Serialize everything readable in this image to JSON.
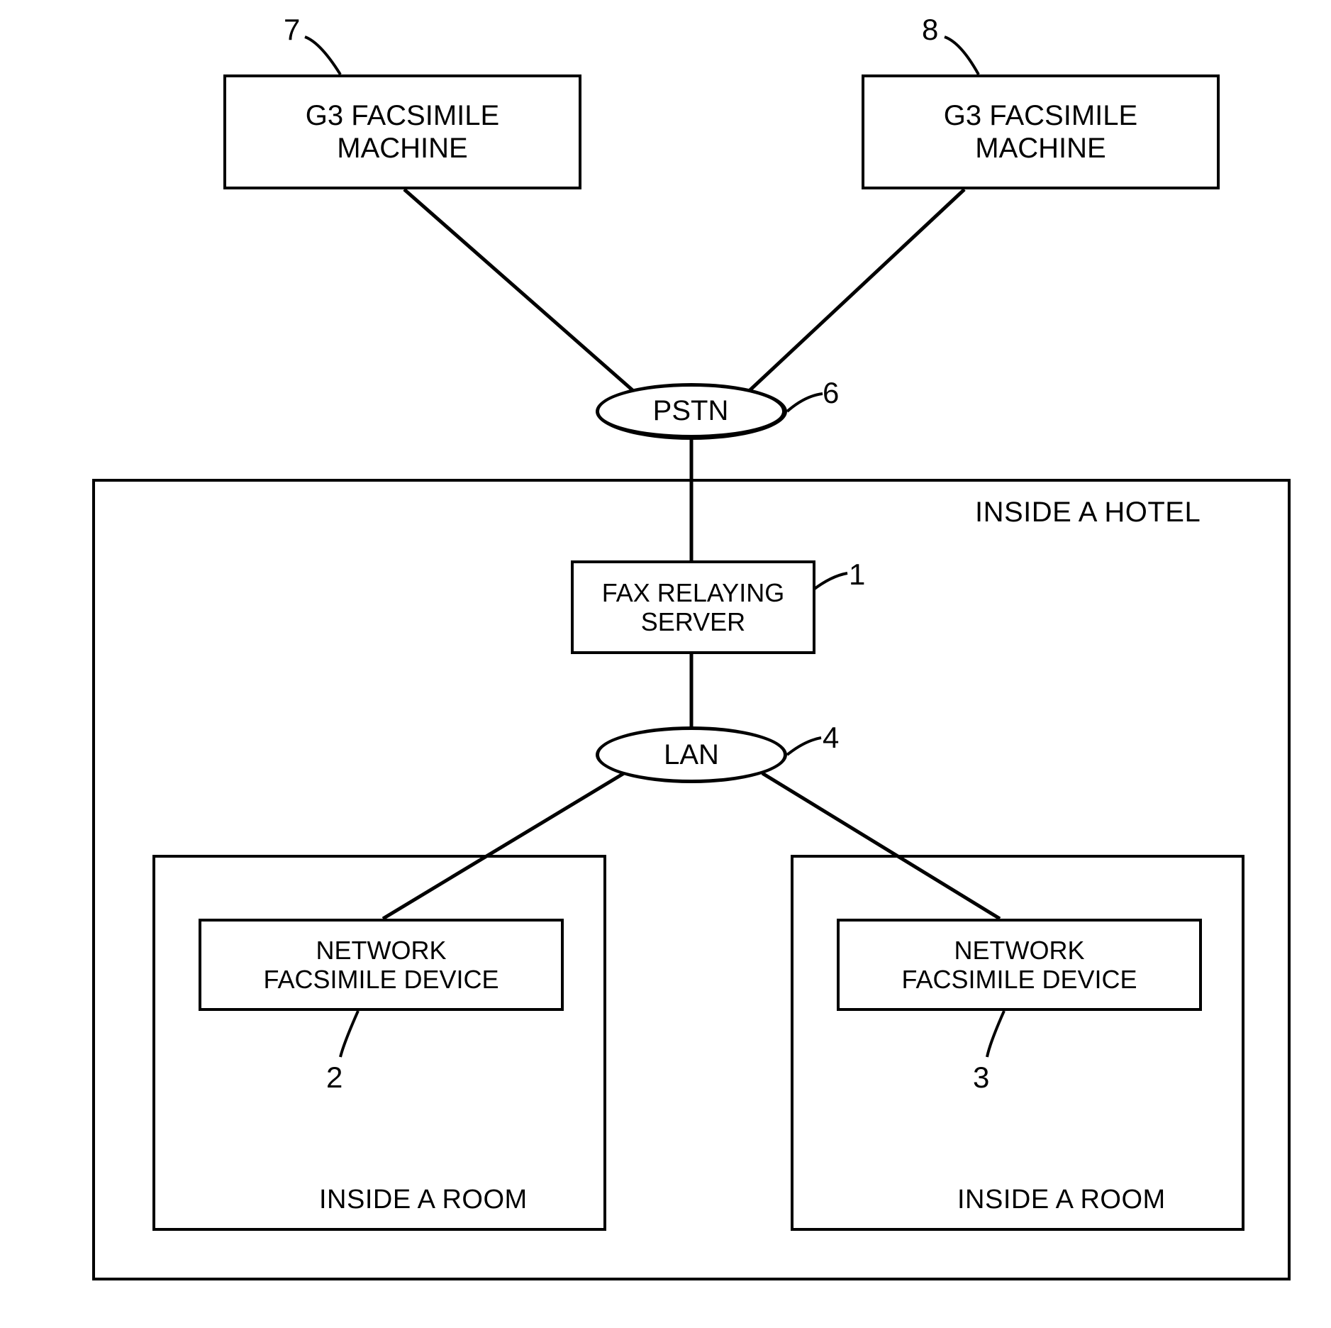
{
  "nodes": {
    "fax7": {
      "label": "G3 FACSIMILE\nMACHINE",
      "ref": "7"
    },
    "fax8": {
      "label": "G3 FACSIMILE\nMACHINE",
      "ref": "8"
    },
    "pstn": {
      "label": "PSTN",
      "ref": "6"
    },
    "relay": {
      "label": "FAX RELAYING\nSERVER",
      "ref": "1"
    },
    "lan": {
      "label": "LAN",
      "ref": "4"
    },
    "dev2": {
      "label": "NETWORK\nFACSIMILE DEVICE",
      "ref": "2"
    },
    "dev3": {
      "label": "NETWORK\nFACSIMILE DEVICE",
      "ref": "3"
    }
  },
  "labels": {
    "hotel": "INSIDE A HOTEL",
    "room_left": "INSIDE A ROOM",
    "room_right": "INSIDE A ROOM"
  }
}
